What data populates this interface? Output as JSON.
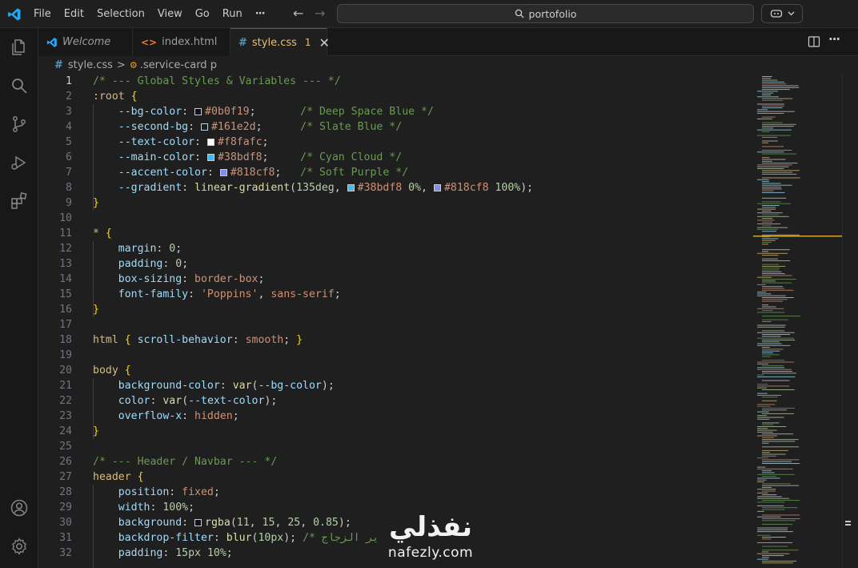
{
  "titlebar": {
    "menu": [
      "File",
      "Edit",
      "Selection",
      "View",
      "Go",
      "Run",
      "···"
    ],
    "search_text": "portofolio"
  },
  "tabs": [
    {
      "label": "Welcome",
      "icon": "vscode-icon",
      "state": "inactive"
    },
    {
      "label": "index.html",
      "icon": "html-icon",
      "state": "inactive"
    },
    {
      "label": "style.css",
      "icon": "css-hash-icon",
      "state": "active",
      "badge": "1"
    }
  ],
  "breadcrumbs": {
    "file": "style.css",
    "separator": ">",
    "symbol": ".service-card p"
  },
  "colors": {
    "bg": "#1f1f1f",
    "activitybar": "#181818",
    "accent": "#0078d4",
    "comment": "#6a9955",
    "selector": "#d7ba7d",
    "property": "#9cdcfe",
    "value": "#ce9178",
    "number": "#b5cea8",
    "function": "#dcdcaa",
    "bracket": "#ffd700"
  },
  "code": [
    {
      "n": "1",
      "tokens": [
        {
          "t": "/* --- Global Styles & Variables --- */",
          "c": "com"
        }
      ]
    },
    {
      "n": "2",
      "tokens": [
        {
          "t": ":root ",
          "c": "sel"
        },
        {
          "t": "{",
          "c": "br"
        }
      ]
    },
    {
      "n": "3",
      "tokens": [
        {
          "t": "    --bg-color",
          "c": "var"
        },
        {
          "t": ": ",
          "c": "pun"
        },
        {
          "sw": "#0b0f19"
        },
        {
          "t": "#0b0f19",
          "c": "val"
        },
        {
          "t": ";       ",
          "c": "pun"
        },
        {
          "t": "/* Deep Space Blue */",
          "c": "com"
        }
      ]
    },
    {
      "n": "4",
      "tokens": [
        {
          "t": "    --second-bg",
          "c": "var"
        },
        {
          "t": ": ",
          "c": "pun"
        },
        {
          "sw": "#161e2d"
        },
        {
          "t": "#161e2d",
          "c": "val"
        },
        {
          "t": ";      ",
          "c": "pun"
        },
        {
          "t": "/* Slate Blue */",
          "c": "com"
        }
      ]
    },
    {
      "n": "5",
      "tokens": [
        {
          "t": "    --text-color",
          "c": "var"
        },
        {
          "t": ": ",
          "c": "pun"
        },
        {
          "sw": "#f8fafc"
        },
        {
          "t": "#f8fafc",
          "c": "val"
        },
        {
          "t": ";",
          "c": "pun"
        }
      ]
    },
    {
      "n": "6",
      "tokens": [
        {
          "t": "    --main-color",
          "c": "var"
        },
        {
          "t": ": ",
          "c": "pun"
        },
        {
          "sw": "#38bdf8"
        },
        {
          "t": "#38bdf8",
          "c": "val"
        },
        {
          "t": ";     ",
          "c": "pun"
        },
        {
          "t": "/* Cyan Cloud */",
          "c": "com"
        }
      ]
    },
    {
      "n": "7",
      "tokens": [
        {
          "t": "    --accent-color",
          "c": "var"
        },
        {
          "t": ": ",
          "c": "pun"
        },
        {
          "sw": "#818cf8"
        },
        {
          "t": "#818cf8",
          "c": "val"
        },
        {
          "t": ";   ",
          "c": "pun"
        },
        {
          "t": "/* Soft Purple */",
          "c": "com"
        }
      ]
    },
    {
      "n": "8",
      "tokens": [
        {
          "t": "    --gradient",
          "c": "var"
        },
        {
          "t": ": ",
          "c": "pun"
        },
        {
          "t": "linear-gradient",
          "c": "fn"
        },
        {
          "t": "(",
          "c": "pun"
        },
        {
          "t": "135deg",
          "c": "num"
        },
        {
          "t": ", ",
          "c": "pun"
        },
        {
          "sw": "#38bdf8"
        },
        {
          "t": "#38bdf8",
          "c": "val"
        },
        {
          "t": " ",
          "c": "pun"
        },
        {
          "t": "0%",
          "c": "num"
        },
        {
          "t": ", ",
          "c": "pun"
        },
        {
          "sw": "#818cf8"
        },
        {
          "t": "#818cf8",
          "c": "val"
        },
        {
          "t": " ",
          "c": "pun"
        },
        {
          "t": "100%",
          "c": "num"
        },
        {
          "t": ");",
          "c": "pun"
        }
      ]
    },
    {
      "n": "9",
      "tokens": [
        {
          "t": "}",
          "c": "br"
        }
      ]
    },
    {
      "n": "10",
      "tokens": []
    },
    {
      "n": "11",
      "tokens": [
        {
          "t": "* ",
          "c": "sel"
        },
        {
          "t": "{",
          "c": "br"
        }
      ]
    },
    {
      "n": "12",
      "tokens": [
        {
          "t": "    margin",
          "c": "var"
        },
        {
          "t": ": ",
          "c": "pun"
        },
        {
          "t": "0",
          "c": "num"
        },
        {
          "t": ";",
          "c": "pun"
        }
      ]
    },
    {
      "n": "13",
      "tokens": [
        {
          "t": "    padding",
          "c": "var"
        },
        {
          "t": ": ",
          "c": "pun"
        },
        {
          "t": "0",
          "c": "num"
        },
        {
          "t": ";",
          "c": "pun"
        }
      ]
    },
    {
      "n": "14",
      "tokens": [
        {
          "t": "    box-sizing",
          "c": "var"
        },
        {
          "t": ": ",
          "c": "pun"
        },
        {
          "t": "border-box",
          "c": "val"
        },
        {
          "t": ";",
          "c": "pun"
        }
      ]
    },
    {
      "n": "15",
      "tokens": [
        {
          "t": "    font-family",
          "c": "var"
        },
        {
          "t": ": ",
          "c": "pun"
        },
        {
          "t": "'Poppins'",
          "c": "val"
        },
        {
          "t": ", ",
          "c": "pun"
        },
        {
          "t": "sans-serif",
          "c": "val"
        },
        {
          "t": ";",
          "c": "pun"
        }
      ]
    },
    {
      "n": "16",
      "tokens": [
        {
          "t": "}",
          "c": "br"
        }
      ]
    },
    {
      "n": "17",
      "tokens": []
    },
    {
      "n": "18",
      "tokens": [
        {
          "t": "html ",
          "c": "sel"
        },
        {
          "t": "{ ",
          "c": "br"
        },
        {
          "t": "scroll-behavior",
          "c": "var"
        },
        {
          "t": ": ",
          "c": "pun"
        },
        {
          "t": "smooth",
          "c": "val"
        },
        {
          "t": "; ",
          "c": "pun"
        },
        {
          "t": "}",
          "c": "br"
        }
      ]
    },
    {
      "n": "19",
      "tokens": []
    },
    {
      "n": "20",
      "tokens": [
        {
          "t": "body ",
          "c": "sel"
        },
        {
          "t": "{",
          "c": "br"
        }
      ]
    },
    {
      "n": "21",
      "tokens": [
        {
          "t": "    background-color",
          "c": "var"
        },
        {
          "t": ": ",
          "c": "pun"
        },
        {
          "t": "var",
          "c": "fn"
        },
        {
          "t": "(",
          "c": "pun"
        },
        {
          "t": "--bg-color",
          "c": "var"
        },
        {
          "t": ");",
          "c": "pun"
        }
      ]
    },
    {
      "n": "22",
      "tokens": [
        {
          "t": "    color",
          "c": "var"
        },
        {
          "t": ": ",
          "c": "pun"
        },
        {
          "t": "var",
          "c": "fn"
        },
        {
          "t": "(",
          "c": "pun"
        },
        {
          "t": "--text-color",
          "c": "var"
        },
        {
          "t": ");",
          "c": "pun"
        }
      ]
    },
    {
      "n": "23",
      "tokens": [
        {
          "t": "    overflow-x",
          "c": "var"
        },
        {
          "t": ": ",
          "c": "pun"
        },
        {
          "t": "hidden",
          "c": "val"
        },
        {
          "t": ";",
          "c": "pun"
        }
      ]
    },
    {
      "n": "24",
      "tokens": [
        {
          "t": "}",
          "c": "br"
        }
      ]
    },
    {
      "n": "25",
      "tokens": []
    },
    {
      "n": "26",
      "tokens": [
        {
          "t": "/* --- Header / Navbar --- */",
          "c": "com"
        }
      ]
    },
    {
      "n": "27",
      "tokens": [
        {
          "t": "header ",
          "c": "sel"
        },
        {
          "t": "{",
          "c": "br"
        }
      ]
    },
    {
      "n": "28",
      "tokens": [
        {
          "t": "    position",
          "c": "var"
        },
        {
          "t": ": ",
          "c": "pun"
        },
        {
          "t": "fixed",
          "c": "val"
        },
        {
          "t": ";",
          "c": "pun"
        }
      ]
    },
    {
      "n": "29",
      "tokens": [
        {
          "t": "    width",
          "c": "var"
        },
        {
          "t": ": ",
          "c": "pun"
        },
        {
          "t": "100%",
          "c": "num"
        },
        {
          "t": ";",
          "c": "pun"
        }
      ]
    },
    {
      "n": "30",
      "tokens": [
        {
          "t": "    background",
          "c": "var"
        },
        {
          "t": ": ",
          "c": "pun"
        },
        {
          "sw": "#0b0f19"
        },
        {
          "t": "rgba",
          "c": "fn"
        },
        {
          "t": "(",
          "c": "pun"
        },
        {
          "t": "11",
          "c": "num"
        },
        {
          "t": ", ",
          "c": "pun"
        },
        {
          "t": "15",
          "c": "num"
        },
        {
          "t": ", ",
          "c": "pun"
        },
        {
          "t": "25",
          "c": "num"
        },
        {
          "t": ", ",
          "c": "pun"
        },
        {
          "t": "0.85",
          "c": "num"
        },
        {
          "t": ");",
          "c": "pun"
        }
      ]
    },
    {
      "n": "31",
      "tokens": [
        {
          "t": "    backdrop-filter",
          "c": "var"
        },
        {
          "t": ": ",
          "c": "pun"
        },
        {
          "t": "blur",
          "c": "fn"
        },
        {
          "t": "(",
          "c": "pun"
        },
        {
          "t": "10px",
          "c": "num"
        },
        {
          "t": "); ",
          "c": "pun"
        },
        {
          "t": "/* ير الزجاج",
          "c": "com"
        }
      ]
    },
    {
      "n": "32",
      "tokens": [
        {
          "t": "    padding",
          "c": "var"
        },
        {
          "t": ": ",
          "c": "pun"
        },
        {
          "t": "15px",
          "c": "num"
        },
        {
          "t": " ",
          "c": "pun"
        },
        {
          "t": "10%",
          "c": "num"
        },
        {
          "t": ";",
          "c": "pun"
        }
      ]
    }
  ],
  "watermark": {
    "arabic": "نفذلي",
    "latin": "nafezly.com"
  }
}
